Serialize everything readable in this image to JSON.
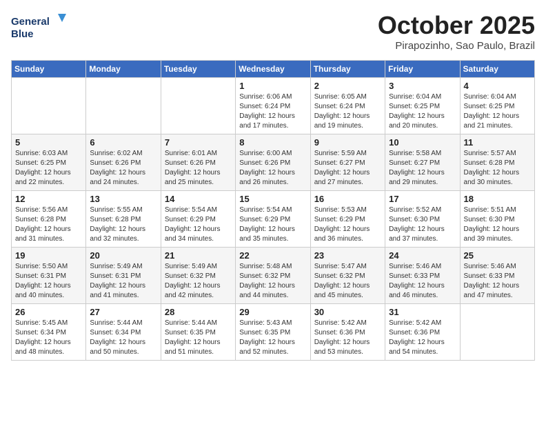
{
  "header": {
    "logo_line1": "General",
    "logo_line2": "Blue",
    "month": "October 2025",
    "location": "Pirapozinho, Sao Paulo, Brazil"
  },
  "weekdays": [
    "Sunday",
    "Monday",
    "Tuesday",
    "Wednesday",
    "Thursday",
    "Friday",
    "Saturday"
  ],
  "weeks": [
    [
      {
        "day": "",
        "sunrise": "",
        "sunset": "",
        "daylight": ""
      },
      {
        "day": "",
        "sunrise": "",
        "sunset": "",
        "daylight": ""
      },
      {
        "day": "",
        "sunrise": "",
        "sunset": "",
        "daylight": ""
      },
      {
        "day": "1",
        "sunrise": "6:06 AM",
        "sunset": "6:24 PM",
        "daylight": "12 hours and 17 minutes."
      },
      {
        "day": "2",
        "sunrise": "6:05 AM",
        "sunset": "6:24 PM",
        "daylight": "12 hours and 19 minutes."
      },
      {
        "day": "3",
        "sunrise": "6:04 AM",
        "sunset": "6:25 PM",
        "daylight": "12 hours and 20 minutes."
      },
      {
        "day": "4",
        "sunrise": "6:04 AM",
        "sunset": "6:25 PM",
        "daylight": "12 hours and 21 minutes."
      }
    ],
    [
      {
        "day": "5",
        "sunrise": "6:03 AM",
        "sunset": "6:25 PM",
        "daylight": "12 hours and 22 minutes."
      },
      {
        "day": "6",
        "sunrise": "6:02 AM",
        "sunset": "6:26 PM",
        "daylight": "12 hours and 24 minutes."
      },
      {
        "day": "7",
        "sunrise": "6:01 AM",
        "sunset": "6:26 PM",
        "daylight": "12 hours and 25 minutes."
      },
      {
        "day": "8",
        "sunrise": "6:00 AM",
        "sunset": "6:26 PM",
        "daylight": "12 hours and 26 minutes."
      },
      {
        "day": "9",
        "sunrise": "5:59 AM",
        "sunset": "6:27 PM",
        "daylight": "12 hours and 27 minutes."
      },
      {
        "day": "10",
        "sunrise": "5:58 AM",
        "sunset": "6:27 PM",
        "daylight": "12 hours and 29 minutes."
      },
      {
        "day": "11",
        "sunrise": "5:57 AM",
        "sunset": "6:28 PM",
        "daylight": "12 hours and 30 minutes."
      }
    ],
    [
      {
        "day": "12",
        "sunrise": "5:56 AM",
        "sunset": "6:28 PM",
        "daylight": "12 hours and 31 minutes."
      },
      {
        "day": "13",
        "sunrise": "5:55 AM",
        "sunset": "6:28 PM",
        "daylight": "12 hours and 32 minutes."
      },
      {
        "day": "14",
        "sunrise": "5:54 AM",
        "sunset": "6:29 PM",
        "daylight": "12 hours and 34 minutes."
      },
      {
        "day": "15",
        "sunrise": "5:54 AM",
        "sunset": "6:29 PM",
        "daylight": "12 hours and 35 minutes."
      },
      {
        "day": "16",
        "sunrise": "5:53 AM",
        "sunset": "6:29 PM",
        "daylight": "12 hours and 36 minutes."
      },
      {
        "day": "17",
        "sunrise": "5:52 AM",
        "sunset": "6:30 PM",
        "daylight": "12 hours and 37 minutes."
      },
      {
        "day": "18",
        "sunrise": "5:51 AM",
        "sunset": "6:30 PM",
        "daylight": "12 hours and 39 minutes."
      }
    ],
    [
      {
        "day": "19",
        "sunrise": "5:50 AM",
        "sunset": "6:31 PM",
        "daylight": "12 hours and 40 minutes."
      },
      {
        "day": "20",
        "sunrise": "5:49 AM",
        "sunset": "6:31 PM",
        "daylight": "12 hours and 41 minutes."
      },
      {
        "day": "21",
        "sunrise": "5:49 AM",
        "sunset": "6:32 PM",
        "daylight": "12 hours and 42 minutes."
      },
      {
        "day": "22",
        "sunrise": "5:48 AM",
        "sunset": "6:32 PM",
        "daylight": "12 hours and 44 minutes."
      },
      {
        "day": "23",
        "sunrise": "5:47 AM",
        "sunset": "6:32 PM",
        "daylight": "12 hours and 45 minutes."
      },
      {
        "day": "24",
        "sunrise": "5:46 AM",
        "sunset": "6:33 PM",
        "daylight": "12 hours and 46 minutes."
      },
      {
        "day": "25",
        "sunrise": "5:46 AM",
        "sunset": "6:33 PM",
        "daylight": "12 hours and 47 minutes."
      }
    ],
    [
      {
        "day": "26",
        "sunrise": "5:45 AM",
        "sunset": "6:34 PM",
        "daylight": "12 hours and 48 minutes."
      },
      {
        "day": "27",
        "sunrise": "5:44 AM",
        "sunset": "6:34 PM",
        "daylight": "12 hours and 50 minutes."
      },
      {
        "day": "28",
        "sunrise": "5:44 AM",
        "sunset": "6:35 PM",
        "daylight": "12 hours and 51 minutes."
      },
      {
        "day": "29",
        "sunrise": "5:43 AM",
        "sunset": "6:35 PM",
        "daylight": "12 hours and 52 minutes."
      },
      {
        "day": "30",
        "sunrise": "5:42 AM",
        "sunset": "6:36 PM",
        "daylight": "12 hours and 53 minutes."
      },
      {
        "day": "31",
        "sunrise": "5:42 AM",
        "sunset": "6:36 PM",
        "daylight": "12 hours and 54 minutes."
      },
      {
        "day": "",
        "sunrise": "",
        "sunset": "",
        "daylight": ""
      }
    ]
  ]
}
